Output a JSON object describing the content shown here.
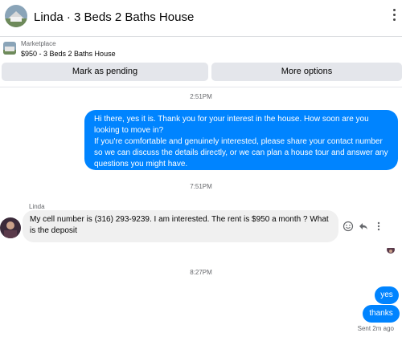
{
  "header": {
    "title": "Linda · 3 Beds 2 Baths House"
  },
  "listing": {
    "source": "Marketplace",
    "title": "$950 - 3 Beds 2 Baths House"
  },
  "buttons": {
    "mark_pending": "Mark as pending",
    "more_options": "More options"
  },
  "messages": {
    "ts1": "2:51PM",
    "outgoing1": [
      "Hi there, yes it is. Thank you for your interest in the house. How soon are you looking to move in?",
      "If you're comfortable and genuinely interested, please share your contact number so we can discuss the details directly, or we can plan a house tour and answer any questions you might have."
    ],
    "ts2": "7:51PM",
    "sender": "Linda",
    "incoming1": "My cell number is (316) 293-9239. I am interested. The rent is $950 a month ? What is the deposit",
    "ts3": "8:27PM",
    "outgoing2": "yes",
    "outgoing3": "thanks",
    "status": "Sent 2m ago"
  },
  "colors": {
    "outgoing_bubble": "#0084ff",
    "incoming_bubble": "#f0f0f0",
    "button_bg": "#e4e6eb"
  },
  "icons": {
    "menu": "more-vertical-icon",
    "emoji": "smiley-icon",
    "reply": "reply-icon",
    "more": "more-vertical-icon"
  }
}
